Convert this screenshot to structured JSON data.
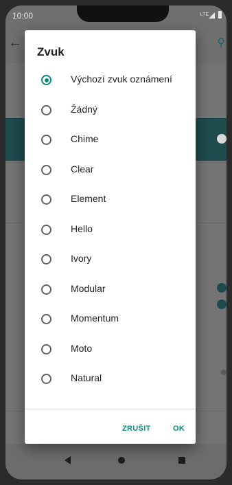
{
  "status_bar": {
    "time": "10:00",
    "network": "LTE"
  },
  "dialog": {
    "title": "Zvuk",
    "selected_index": 0,
    "options": [
      {
        "label": "Výchozí zvuk oznámení",
        "selected": true
      },
      {
        "label": "Žádný",
        "selected": false
      },
      {
        "label": "Chime",
        "selected": false
      },
      {
        "label": "Clear",
        "selected": false
      },
      {
        "label": "Element",
        "selected": false
      },
      {
        "label": "Hello",
        "selected": false
      },
      {
        "label": "Ivory",
        "selected": false
      },
      {
        "label": "Modular",
        "selected": false
      },
      {
        "label": "Momentum",
        "selected": false
      },
      {
        "label": "Moto",
        "selected": false
      },
      {
        "label": "Natural",
        "selected": false
      }
    ],
    "cancel_label": "ZRUŠIT",
    "ok_label": "OK"
  },
  "colors": {
    "accent": "#0a8a7e",
    "scrim": "#747474",
    "dialog_bg": "#ffffff"
  },
  "nav_bar": {
    "icons": [
      "back-icon",
      "home-icon",
      "recents-icon"
    ]
  }
}
